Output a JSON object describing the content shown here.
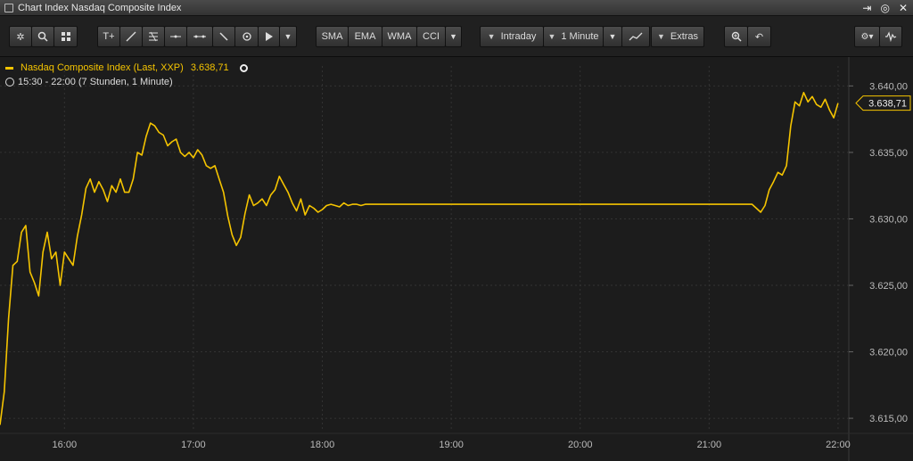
{
  "window": {
    "title": "Chart Index Nasdaq Composite Index"
  },
  "toolbar": {
    "sma": "SMA",
    "ema": "EMA",
    "wma": "WMA",
    "cci": "CCI",
    "interval_type": "Intraday",
    "interval": "1 Minute",
    "extras": "Extras"
  },
  "legend": {
    "series": "Nasdaq Composite Index (Last, XXP)",
    "last_value": "3.638,71",
    "timeframe": "15:30 - 22:00 (7 Stunden, 1 Minute)"
  },
  "colors": {
    "series": "#f5c400",
    "background": "#1c1c1c",
    "grid": "#333333",
    "axis_text": "#bbbbbb"
  },
  "chart_data": {
    "type": "line",
    "ylim": [
      3614,
      3641.5
    ],
    "xlim": [
      "15:30",
      "22:05"
    ],
    "y_ticks": [
      "3.615,00",
      "3.620,00",
      "3.625,00",
      "3.630,00",
      "3.635,00",
      "3.640,00"
    ],
    "y_tick_values": [
      3615,
      3620,
      3625,
      3630,
      3635,
      3640
    ],
    "x_ticks": [
      "16:00",
      "17:00",
      "18:00",
      "19:00",
      "20:00",
      "21:00",
      "22:00"
    ],
    "last_label": "3.638,71",
    "last_value": 3638.71,
    "series": [
      {
        "name": "Nasdaq Composite Index (Last, XXP)",
        "x": [
          "15:30",
          "15:32",
          "15:34",
          "15:36",
          "15:38",
          "15:40",
          "15:42",
          "15:44",
          "15:46",
          "15:48",
          "15:50",
          "15:52",
          "15:54",
          "15:56",
          "15:58",
          "16:00",
          "16:02",
          "16:04",
          "16:06",
          "16:08",
          "16:10",
          "16:12",
          "16:14",
          "16:16",
          "16:18",
          "16:20",
          "16:22",
          "16:24",
          "16:26",
          "16:28",
          "16:30",
          "16:32",
          "16:34",
          "16:36",
          "16:38",
          "16:40",
          "16:42",
          "16:44",
          "16:46",
          "16:48",
          "16:50",
          "16:52",
          "16:54",
          "16:56",
          "16:58",
          "17:00",
          "17:02",
          "17:04",
          "17:06",
          "17:08",
          "17:10",
          "17:12",
          "17:14",
          "17:16",
          "17:18",
          "17:20",
          "17:22",
          "17:24",
          "17:26",
          "17:28",
          "17:30",
          "17:32",
          "17:34",
          "17:36",
          "17:38",
          "17:40",
          "17:42",
          "17:44",
          "17:46",
          "17:48",
          "17:50",
          "17:52",
          "17:54",
          "17:56",
          "17:58",
          "18:00",
          "18:02",
          "18:04",
          "18:06",
          "18:08",
          "18:10",
          "18:12",
          "18:14",
          "18:16",
          "18:18",
          "18:20",
          "18:25",
          "18:30",
          "19:00",
          "19:30",
          "20:00",
          "20:30",
          "21:00",
          "21:20",
          "21:24",
          "21:26",
          "21:28",
          "21:30",
          "21:32",
          "21:34",
          "21:36",
          "21:38",
          "21:40",
          "21:42",
          "21:44",
          "21:46",
          "21:48",
          "21:50",
          "21:52",
          "21:54",
          "21:56",
          "21:58",
          "22:00"
        ],
        "values": [
          3614.5,
          3617.0,
          3622.5,
          3626.5,
          3626.8,
          3629.0,
          3629.5,
          3626.0,
          3625.2,
          3624.2,
          3627.5,
          3629.0,
          3627.0,
          3627.5,
          3625.0,
          3627.5,
          3627.0,
          3626.5,
          3628.7,
          3630.3,
          3632.3,
          3633.0,
          3632.0,
          3632.8,
          3632.2,
          3631.3,
          3632.5,
          3632.0,
          3633.0,
          3632.0,
          3632.0,
          3633.0,
          3635.0,
          3634.8,
          3636.2,
          3637.2,
          3637.0,
          3636.5,
          3636.3,
          3635.5,
          3635.8,
          3636.0,
          3635.0,
          3634.7,
          3635.0,
          3634.6,
          3635.2,
          3634.8,
          3634.0,
          3633.8,
          3634.0,
          3633.0,
          3632.0,
          3630.2,
          3628.8,
          3628.0,
          3628.6,
          3630.4,
          3631.8,
          3631.0,
          3631.2,
          3631.5,
          3631.0,
          3631.8,
          3632.2,
          3633.2,
          3632.6,
          3632.0,
          3631.2,
          3630.6,
          3631.5,
          3630.3,
          3631.0,
          3630.8,
          3630.5,
          3630.7,
          3631.0,
          3631.1,
          3631.0,
          3630.9,
          3631.2,
          3631.0,
          3631.1,
          3631.1,
          3631.0,
          3631.1,
          3631.1,
          3631.1,
          3631.1,
          3631.1,
          3631.1,
          3631.1,
          3631.1,
          3631.1,
          3630.5,
          3631.0,
          3632.2,
          3632.8,
          3633.5,
          3633.3,
          3634.0,
          3637.0,
          3638.8,
          3638.5,
          3639.5,
          3638.8,
          3639.2,
          3638.6,
          3638.4,
          3639.0,
          3638.2,
          3637.6,
          3638.7
        ]
      }
    ]
  }
}
